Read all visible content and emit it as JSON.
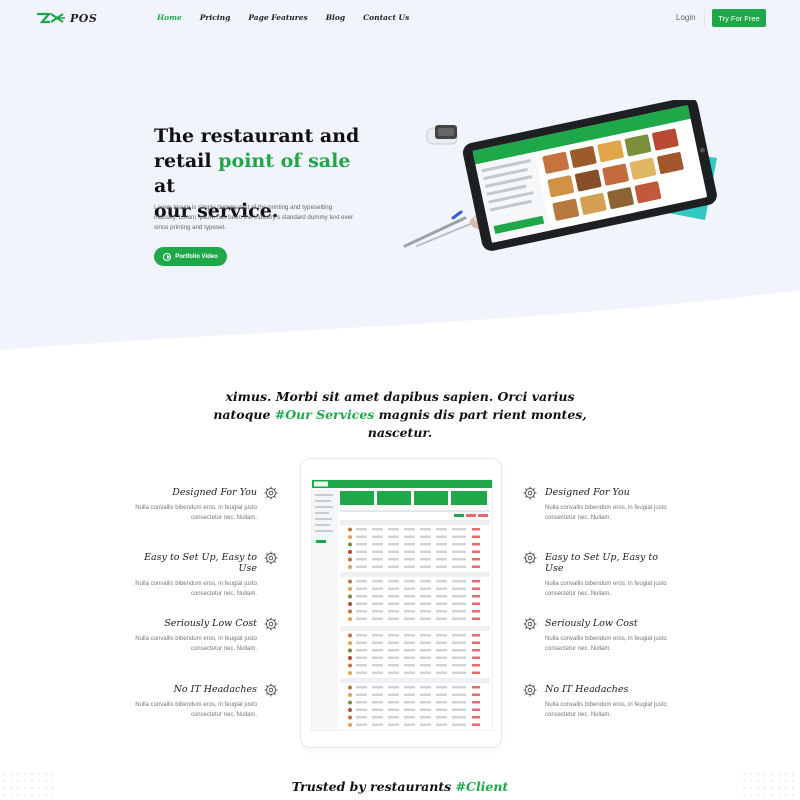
{
  "nav": {
    "logo_text": "POS",
    "menu": [
      "Home",
      "Pricing",
      "Page Features",
      "Blog",
      "Contact Us"
    ],
    "login": "Login",
    "cta": "Try For Free"
  },
  "hero": {
    "title_line1": "The restaurant and",
    "title_line2a": "retail ",
    "title_line2b": "point of sale",
    "title_line2c": " at",
    "title_line3": "our service.",
    "description": "Lorem Ipsum is simply dummy text of the printing and typesetting industry. Lorem Ipsum has been the industry's standard dummy text ever since printing and typeset.",
    "video_button": "Portfolio Video"
  },
  "services": {
    "heading_a": "ximus. Morbi sit amet dapibus sapien. Orci varius natoque ",
    "heading_b": "#Our Services",
    "heading_c": " magnis dis part rient montes, nascetur.",
    "left": [
      {
        "title": "Designed For You",
        "desc": "Nulla convallis bibendum eros, in feugiat justo consectetur nec. Nullam."
      },
      {
        "title": "Easy to Set Up, Easy to Use",
        "desc": "Nulla convallis bibendum eros, in feugiat justo consectetur nec. Nullam."
      },
      {
        "title": "Seriously Low Cost",
        "desc": "Nulla convallis bibendum eros, in feugiat justo consectetur nec. Nullam."
      },
      {
        "title": "No IT Headaches",
        "desc": "Nulla convallis bibendum eros, in feugiat justo consectetur nec. Nullam."
      }
    ],
    "right": [
      {
        "title": "Designed For You",
        "desc": "Nulla convallis bibendum eros, in feugiat justo consectetur nec. Nullam."
      },
      {
        "title": "Easy to Set Up, Easy to Use",
        "desc": "Nulla convallis bibendum eros, in feugiat justo consectetur nec. Nullam."
      },
      {
        "title": "Seriously Low Cost",
        "desc": "Nulla convallis bibendum eros, in feugiat justo consectetur nec. Nullam."
      },
      {
        "title": "No IT Headaches",
        "desc": "Nulla convallis bibendum eros, in feugiat justo consectetur nec. Nullam."
      }
    ]
  },
  "clients": {
    "heading_a": "Trusted by restaurants ",
    "heading_b": "#Client"
  },
  "colors": {
    "accent": "#1ea84a",
    "hero_bg": "#f1f5fb",
    "text_dark": "#111111"
  },
  "icons": {
    "feature": "gear-icon",
    "play": "play-icon",
    "logo": "logo-mark-icon"
  }
}
